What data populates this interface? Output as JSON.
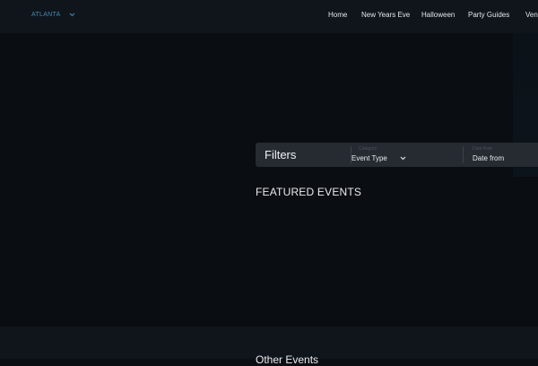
{
  "header": {
    "city": "ATLANTA",
    "nav": [
      "Home",
      "New Years Eve",
      "Halloween",
      "Party Guides",
      "Venu"
    ]
  },
  "filters": {
    "title": "Filters",
    "event_type": {
      "label": "Category",
      "value": "Event Type"
    },
    "date": {
      "label": "Date from",
      "value": "Date from"
    }
  },
  "sections": {
    "featured_title": "FEATURED EVENTS",
    "other_title": "Other Events"
  },
  "colors": {
    "background": "#0b0e12",
    "header_bg": "#10151c",
    "accent": "#3a8fb7",
    "filter_bar": "#262b32"
  }
}
